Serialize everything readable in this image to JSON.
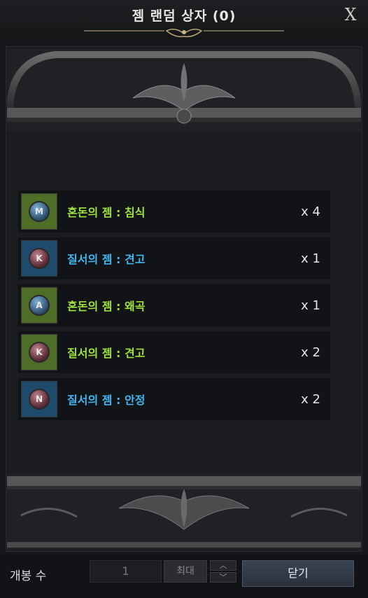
{
  "window": {
    "title": "젬 랜덤 상자 (0)",
    "close_label": "X"
  },
  "items": [
    {
      "name": "혼돈의 젬 : 침식",
      "count": "x 4",
      "type": "chaos",
      "gem_color": "blue",
      "glyph": "M"
    },
    {
      "name": "질서의 젬 : 견고",
      "count": "x 1",
      "type": "order",
      "gem_color": "red",
      "glyph": "K"
    },
    {
      "name": "혼돈의 젬 : 왜곡",
      "count": "x 1",
      "type": "chaos",
      "gem_color": "blue",
      "glyph": "A"
    },
    {
      "name": "질서의 젬 : 견고",
      "count": "x 2",
      "type": "chaos",
      "gem_color": "red",
      "glyph": "K"
    },
    {
      "name": "질서의 젬 : 안정",
      "count": "x 2",
      "type": "order",
      "gem_color": "red",
      "glyph": "N"
    }
  ],
  "footer": {
    "open_count_label": "개봉 수",
    "quantity_value": "1",
    "max_label": "최대",
    "up_symbol": "︿",
    "down_symbol": "﹀",
    "close_button_label": "닫기"
  },
  "colors": {
    "chaos_text": "#9ee23a",
    "order_text": "#3fb6f0",
    "chaos_slot": "#4e6d26",
    "order_slot": "#1e4a6b"
  }
}
